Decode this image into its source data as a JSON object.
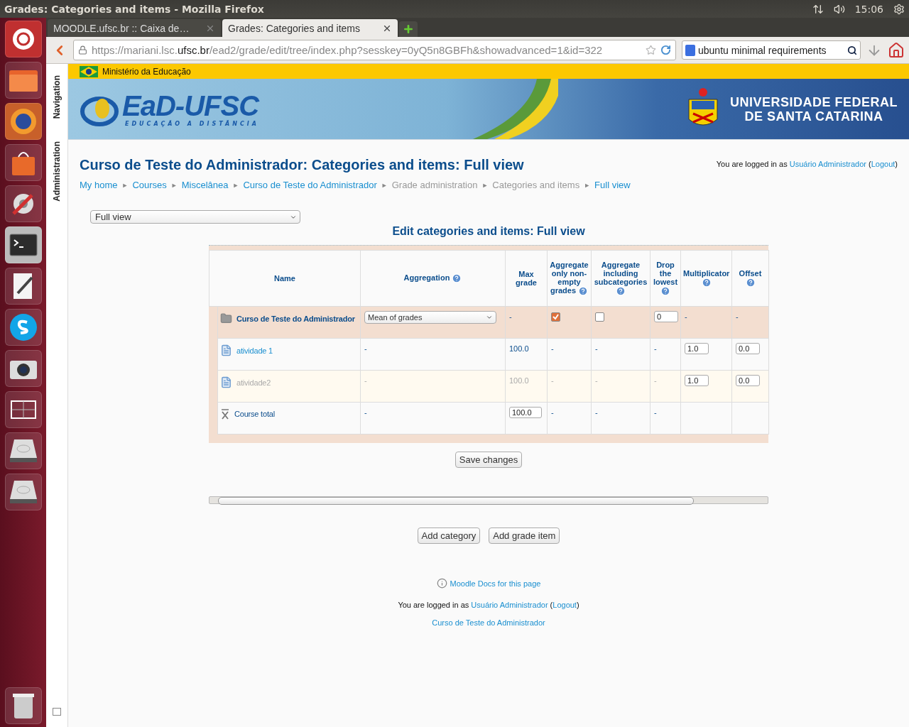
{
  "window": {
    "title": "Grades: Categories and items - Mozilla Firefox",
    "clock": "15:06"
  },
  "browser": {
    "tabs": [
      {
        "label": "MOODLE.ufsc.br :: Caixa de…",
        "selected": false
      },
      {
        "label": "Grades: Categories and items",
        "selected": true
      }
    ],
    "url": {
      "before": "https://mariani.lsc.",
      "domain": "ufsc.br",
      "after": "/ead2/grade/edit/tree/index.php?sesskey=0yQ5n8GBFh&showadvanced=1&id=322"
    },
    "search": {
      "value": "ubuntu minimal requirements"
    }
  },
  "gov_bar": {
    "label": "Ministério da Educação"
  },
  "banner": {
    "logo": "EaD-UFSC",
    "logo_subtitle": "EDUCAÇÃO A DISTÂNCIA",
    "university": [
      "UNIVERSIDADE FEDERAL",
      "DE SANTA CATARINA"
    ]
  },
  "side_tabs": [
    "Navigation",
    "Administration"
  ],
  "page": {
    "heading": "Curso de Teste do Administrador: Categories and items: Full view",
    "login": {
      "before": "You are logged in as ",
      "user": "Usuário Administrador",
      "open": " (",
      "logout": "Logout",
      "close": ")"
    },
    "breadcrumb": {
      "separator": "►",
      "items": [
        {
          "label": "My home",
          "link": true
        },
        {
          "label": "Courses",
          "link": true
        },
        {
          "label": "Miscelânea",
          "link": true
        },
        {
          "label": "Curso de Teste do Administrador",
          "link": true
        },
        {
          "label": "Grade administration",
          "link": false
        },
        {
          "label": "Categories and items",
          "link": false
        },
        {
          "label": "Full view",
          "link": true
        }
      ]
    },
    "view_select": "Full view",
    "table_title": "Edit categories and items: Full view"
  },
  "table": {
    "columns": [
      {
        "label": "Name",
        "help": false
      },
      {
        "label": "Aggregation",
        "help": true
      },
      {
        "label": "Max grade",
        "help": false
      },
      {
        "label": "Aggregate only non-empty grades",
        "help": true
      },
      {
        "label": "Aggregate including subcategories",
        "help": true
      },
      {
        "label": "Drop the lowest",
        "help": true
      },
      {
        "label": "Multiplicator",
        "help": true
      },
      {
        "label": "Offset",
        "help": true
      }
    ],
    "rows": [
      {
        "kind": "category",
        "dimmed": false,
        "cells": [
          {
            "kind": "name",
            "value": "Curso de Teste do Administrador"
          },
          {
            "kind": "select",
            "value": "Mean of grades"
          },
          {
            "kind": "text",
            "value": "-"
          },
          {
            "kind": "checkbox",
            "checked": true
          },
          {
            "kind": "checkbox",
            "checked": false
          },
          {
            "kind": "field",
            "value": "0"
          },
          {
            "kind": "text",
            "value": "-"
          },
          {
            "kind": "text",
            "value": "-"
          }
        ]
      },
      {
        "kind": "item",
        "dimmed": false,
        "cells": [
          {
            "kind": "name",
            "value": "atividade 1"
          },
          {
            "kind": "text",
            "value": "-"
          },
          {
            "kind": "text",
            "value": "100.0"
          },
          {
            "kind": "text",
            "value": "-"
          },
          {
            "kind": "text",
            "value": "-"
          },
          {
            "kind": "text",
            "value": "-"
          },
          {
            "kind": "field",
            "value": "1.0"
          },
          {
            "kind": "field",
            "value": "0.0"
          }
        ]
      },
      {
        "kind": "item",
        "dimmed": true,
        "cells": [
          {
            "kind": "name",
            "value": "atividade2"
          },
          {
            "kind": "text",
            "value": "-"
          },
          {
            "kind": "text",
            "value": "100.0"
          },
          {
            "kind": "text",
            "value": "-"
          },
          {
            "kind": "text",
            "value": "-"
          },
          {
            "kind": "text",
            "value": "-"
          },
          {
            "kind": "field",
            "value": "1.0"
          },
          {
            "kind": "field",
            "value": "0.0"
          }
        ]
      },
      {
        "kind": "total",
        "dimmed": false,
        "cells": [
          {
            "kind": "name",
            "value": "Course total"
          },
          {
            "kind": "text",
            "value": "-"
          },
          {
            "kind": "field",
            "value": "100.0"
          },
          {
            "kind": "text",
            "value": "-"
          },
          {
            "kind": "text",
            "value": "-"
          },
          {
            "kind": "text",
            "value": "-"
          },
          {
            "kind": "blank"
          },
          {
            "kind": "blank"
          }
        ]
      }
    ]
  },
  "buttons": {
    "save": "Save changes",
    "add": [
      "Add category",
      "Add grade item"
    ]
  },
  "footer": {
    "docs": "Moodle Docs for this page",
    "login": {
      "before": "You are logged in as ",
      "user": "Usuário Administrador",
      "open": " (",
      "logout": "Logout",
      "close": ")"
    },
    "course": "Curso de Teste do Administrador"
  }
}
